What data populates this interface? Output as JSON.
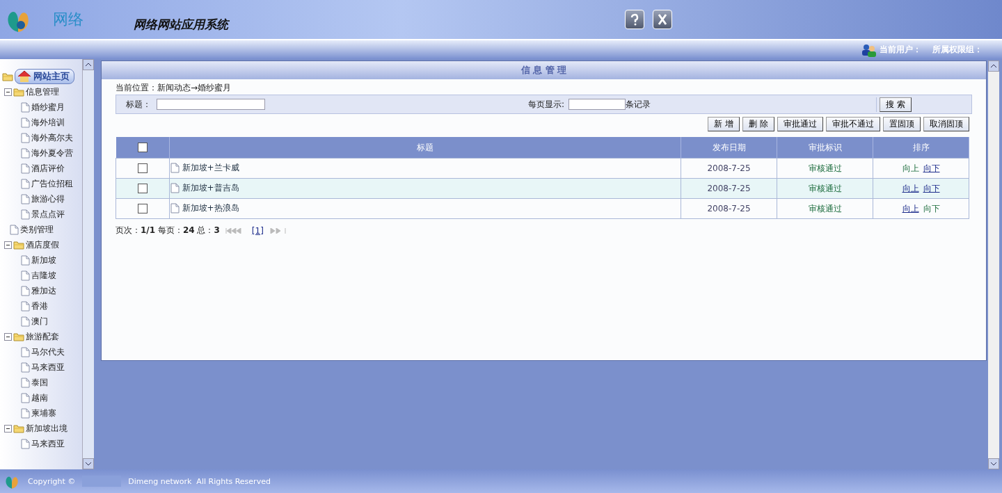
{
  "header": {
    "logo_text": "网络",
    "system_title": "网络网站应用系统",
    "current_user_label": "当前用户：",
    "permission_group_label": "所属权限组："
  },
  "sidebar": {
    "home": "网站主页",
    "tree": [
      {
        "label": "信息管理",
        "kind": "folder",
        "expanded": true,
        "children": [
          {
            "label": "婚纱蜜月",
            "kind": "page"
          },
          {
            "label": "海外培训",
            "kind": "page"
          },
          {
            "label": "海外高尔夫",
            "kind": "page"
          },
          {
            "label": "海外夏令营",
            "kind": "page"
          },
          {
            "label": "酒店评价",
            "kind": "page"
          },
          {
            "label": "广告位招租",
            "kind": "page"
          },
          {
            "label": "旅游心得",
            "kind": "page"
          },
          {
            "label": "景点点评",
            "kind": "page"
          }
        ]
      },
      {
        "label": "类别管理",
        "kind": "page"
      },
      {
        "label": "酒店度假",
        "kind": "folder",
        "expanded": true,
        "children": [
          {
            "label": "新加坡",
            "kind": "page"
          },
          {
            "label": "吉隆坡",
            "kind": "page"
          },
          {
            "label": "雅加达",
            "kind": "page"
          },
          {
            "label": "香港",
            "kind": "page"
          },
          {
            "label": "澳门",
            "kind": "page"
          }
        ]
      },
      {
        "label": "旅游配套",
        "kind": "folder",
        "expanded": true,
        "children": [
          {
            "label": "马尔代夫",
            "kind": "page"
          },
          {
            "label": "马来西亚",
            "kind": "page"
          },
          {
            "label": "泰国",
            "kind": "page"
          },
          {
            "label": "越南",
            "kind": "page"
          },
          {
            "label": "柬埔寨",
            "kind": "page"
          }
        ]
      },
      {
        "label": "新加坡出境",
        "kind": "folder",
        "expanded": true,
        "children": [
          {
            "label": "马来西亚",
            "kind": "page"
          }
        ]
      }
    ]
  },
  "panel": {
    "title": "信 息 管 理",
    "breadcrumb": "当前位置：新闻动态→婚纱蜜月",
    "search": {
      "title_label": "标题：",
      "per_page_label": "每页显示:",
      "per_page_suffix": "条记录",
      "button": "搜 索"
    },
    "actions": [
      "新 增",
      "删 除",
      "审批通过",
      "审批不通过",
      "置固顶",
      "取消固顶"
    ],
    "table": {
      "select_all_checked": false,
      "columns": [
        "标题",
        "发布日期",
        "审批标识",
        "排序"
      ],
      "rows": [
        {
          "checked": false,
          "title": "新加坡+兰卡威",
          "date": "2008-7-25",
          "status": "审核通过",
          "sort": [
            {
              "label": "向上",
              "link": false
            },
            {
              "label": "向下",
              "link": true
            }
          ]
        },
        {
          "checked": false,
          "title": "新加坡+普吉岛",
          "date": "2008-7-25",
          "status": "审核通过",
          "sort": [
            {
              "label": "向上",
              "link": true
            },
            {
              "label": "向下",
              "link": true
            }
          ]
        },
        {
          "checked": false,
          "title": "新加坡+热浪岛",
          "date": "2008-7-25",
          "status": "审核通过",
          "sort": [
            {
              "label": "向上",
              "link": true
            },
            {
              "label": "向下",
              "link": false
            }
          ]
        }
      ]
    },
    "pager": {
      "text": "页次：**1/1** 每页：**24** 总：**3**",
      "page_link": "[1]"
    }
  },
  "footer": {
    "copyright": "Copyright ©",
    "rights": "Dimeng network  All Rights Reserved"
  }
}
